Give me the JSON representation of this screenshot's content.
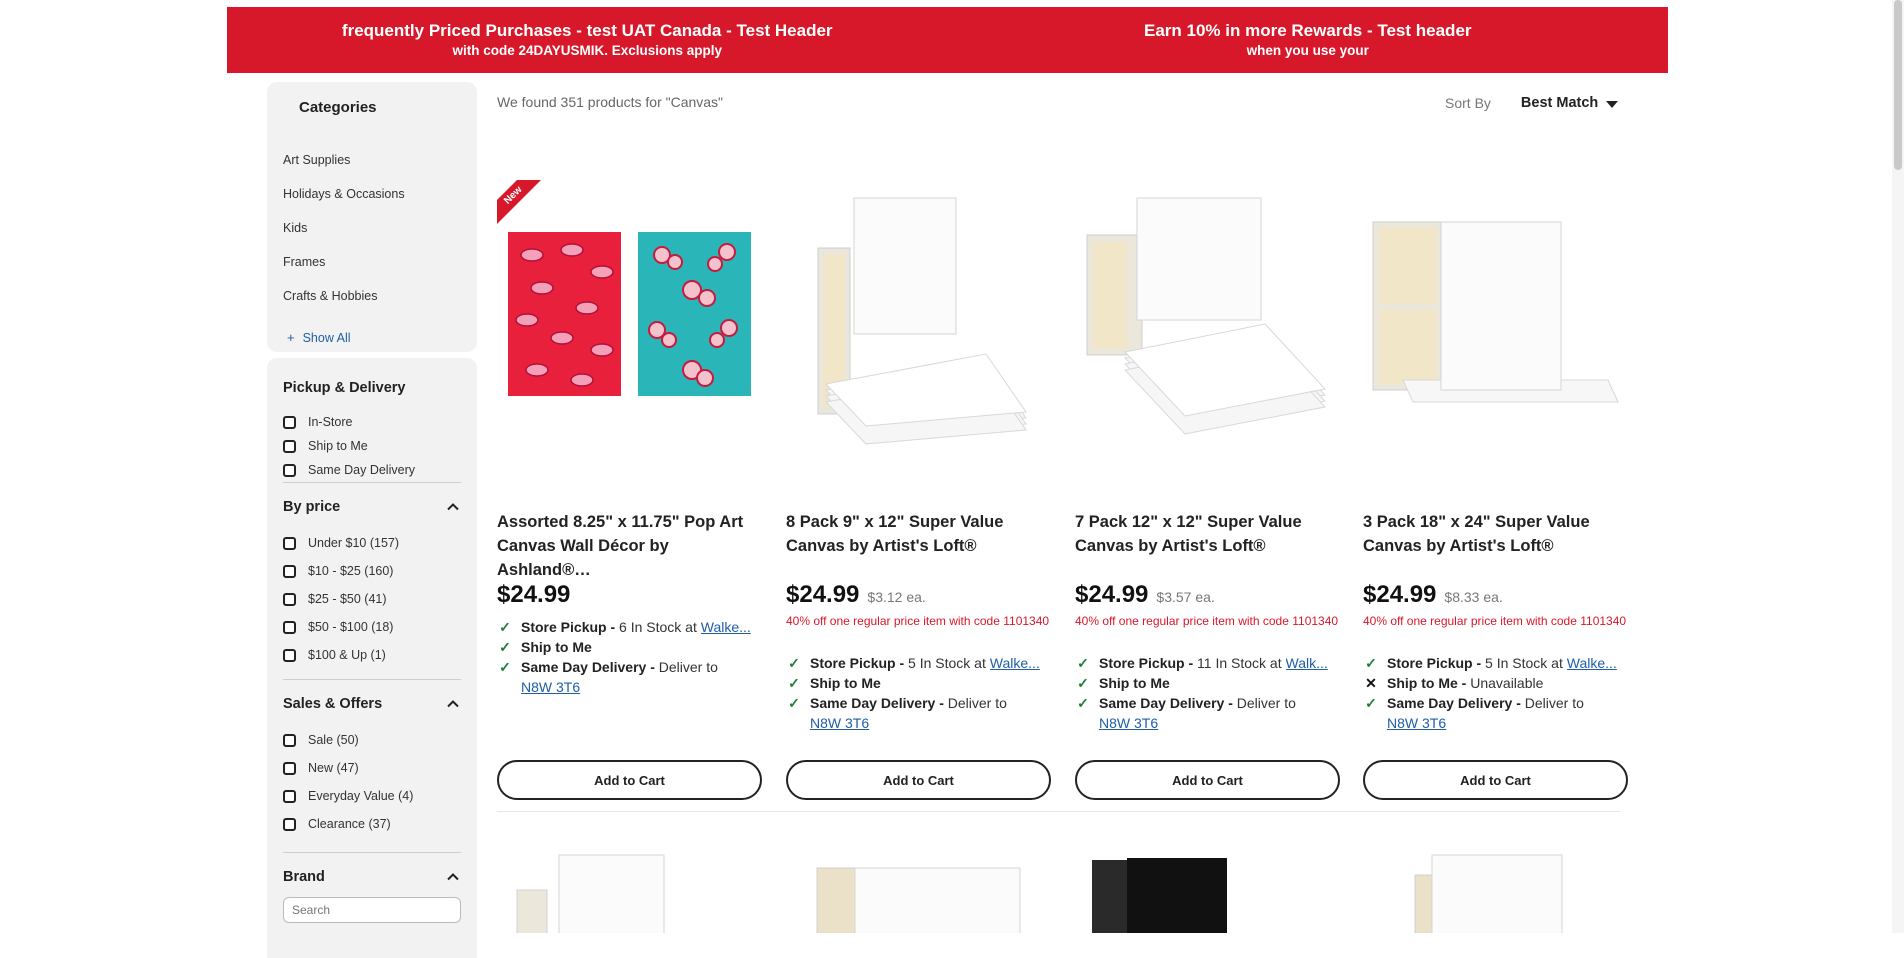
{
  "banner": {
    "left": {
      "title": "frequently Priced Purchases - test UAT Canada - Test Header",
      "sub": "with code 24DAYUSMIK. Exclusions apply"
    },
    "right": {
      "title": "Earn 10% in more Rewards - Test header",
      "sub": "when you use your"
    }
  },
  "sidebar": {
    "categories_title": "Categories",
    "categories": [
      "Art Supplies",
      "Holidays & Occasions",
      "Kids",
      "Frames",
      "Crafts & Hobbies"
    ],
    "show_all": "Show All",
    "pickup": {
      "title": "Pickup & Delivery",
      "options": [
        "In-Store",
        "Ship to Me",
        "Same Day Delivery"
      ]
    },
    "price": {
      "title": "By price",
      "options": [
        "Under $10 (157)",
        "$10 - $25 (160)",
        "$25 - $50 (41)",
        "$50 - $100 (18)",
        "$100 & Up (1)"
      ]
    },
    "sales": {
      "title": "Sales & Offers",
      "options": [
        "Sale (50)",
        "New (47)",
        "Everyday Value (4)",
        "Clearance (37)"
      ]
    },
    "brand": {
      "title": "Brand",
      "placeholder": "Search"
    }
  },
  "results_text": "We found 351 products for \"Canvas\"",
  "sort": {
    "label": "Sort By",
    "value": "Best Match"
  },
  "badge_new": "New",
  "products": [
    {
      "name": "Assorted 8.25\" x 11.75\" Pop Art Canvas Wall Décor by Ashland®…",
      "price": "$24.99",
      "each": "",
      "promo": "",
      "pickup_label": "Store Pickup -",
      "pickup_stock": "6 In Stock at",
      "pickup_store": "Walke...",
      "ship_label": "Ship to Me",
      "ship_status": "",
      "sameday_label": "Same Day Delivery -",
      "sameday_text": "Deliver to",
      "postal": "N8W 3T6",
      "cta": "Add to Cart"
    },
    {
      "name": "8 Pack 9\" x 12\" Super Value Canvas by Artist's Loft®",
      "price": "$24.99",
      "each": "$3.12 ea.",
      "promo": "40% off one regular price item with code 1101340",
      "pickup_label": "Store Pickup -",
      "pickup_stock": "5 In Stock at",
      "pickup_store": "Walke...",
      "ship_label": "Ship to Me",
      "ship_status": "",
      "sameday_label": "Same Day Delivery -",
      "sameday_text": "Deliver to",
      "postal": "N8W 3T6",
      "cta": "Add to Cart"
    },
    {
      "name": "7 Pack 12\" x 12\" Super Value Canvas by Artist's Loft®",
      "price": "$24.99",
      "each": "$3.57 ea.",
      "promo": "40% off one regular price item with code 1101340",
      "pickup_label": "Store Pickup -",
      "pickup_stock": "11 In Stock at",
      "pickup_store": "Walk...",
      "ship_label": "Ship to Me",
      "ship_status": "",
      "sameday_label": "Same Day Delivery -",
      "sameday_text": "Deliver to",
      "postal": "N8W 3T6",
      "cta": "Add to Cart"
    },
    {
      "name": "3 Pack 18\" x 24\" Super Value Canvas by Artist's Loft®",
      "price": "$24.99",
      "each": "$8.33 ea.",
      "promo": "40% off one regular price item with code 1101340",
      "pickup_label": "Store Pickup -",
      "pickup_stock": "5 In Stock at",
      "pickup_store": "Walke...",
      "ship_label": "Ship to Me -",
      "ship_status": "Unavailable",
      "sameday_label": "Same Day Delivery -",
      "sameday_text": "Deliver to",
      "postal": "N8W 3T6",
      "cta": "Add to Cart"
    }
  ]
}
